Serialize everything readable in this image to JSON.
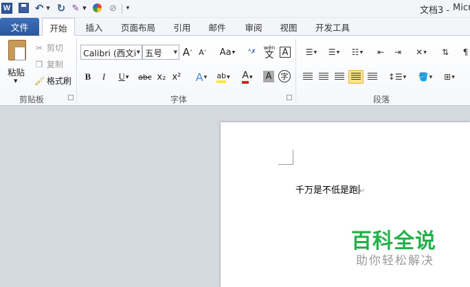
{
  "titlebar": {
    "document_title": "文档3 -",
    "app_title_fragment": "Micr"
  },
  "tabs": [
    "文件",
    "开始",
    "插入",
    "页面布局",
    "引用",
    "邮件",
    "审阅",
    "视图",
    "开发工具"
  ],
  "clipboard": {
    "paste": "粘贴",
    "cut": "剪切",
    "copy": "复制",
    "format_painter": "格式刷",
    "group_label": "剪贴板"
  },
  "font": {
    "font_name": "Calibri (西文i",
    "font_size": "五号",
    "group_label": "字体",
    "grow_glyph": "A",
    "shrink_glyph": "A",
    "case_glyph": "Aa",
    "phonetic_glyph": "wén",
    "phonetic_sub": "文",
    "border_glyph": "A",
    "bold": "B",
    "italic": "I",
    "underline": "U",
    "strike": "abc",
    "subscript": "x₂",
    "superscript": "x²",
    "effects_glyph": "A",
    "highlight_glyph": "ab",
    "color_glyph": "A",
    "shading_glyph": "A",
    "enclose_glyph": "字"
  },
  "paragraph": {
    "group_label": "段落"
  },
  "document": {
    "text": "千万是不低是跑",
    "watermark_title": "百科全说",
    "watermark_subtitle": "助你轻松解决"
  },
  "colors": {
    "file_tab": "#2a579a",
    "watermark_green": "#23b04a",
    "highlight_yellow": "#fde389"
  }
}
